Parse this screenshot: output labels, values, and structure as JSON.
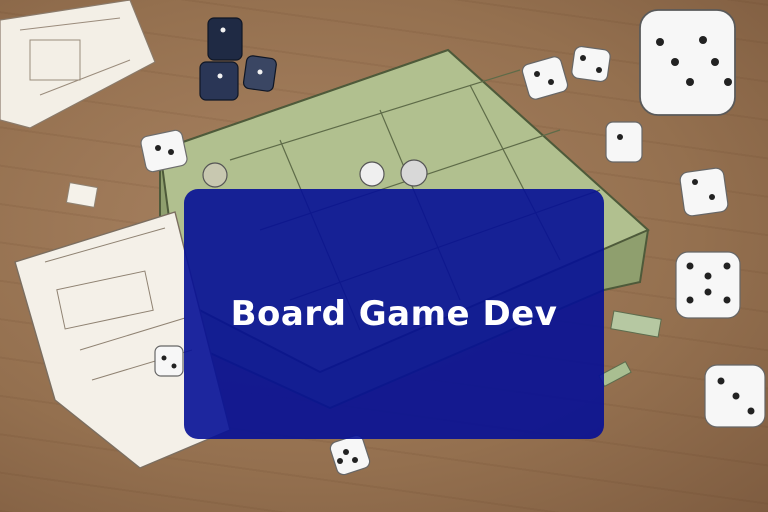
{
  "card": {
    "title": "Board Game Dev"
  },
  "colors": {
    "table_wood": "#a07a58",
    "game_board": "#a9b88a",
    "paper": "#f3efe6",
    "card_overlay": "#0a1896",
    "dice_white": "#f7f7f7",
    "dice_navy": "#1f2a44",
    "title_text": "#ffffff"
  },
  "illustration": {
    "objects": [
      "game-board",
      "rule-sheet",
      "sketch-sheet",
      "white-dice",
      "navy-dice",
      "game-pieces"
    ]
  }
}
